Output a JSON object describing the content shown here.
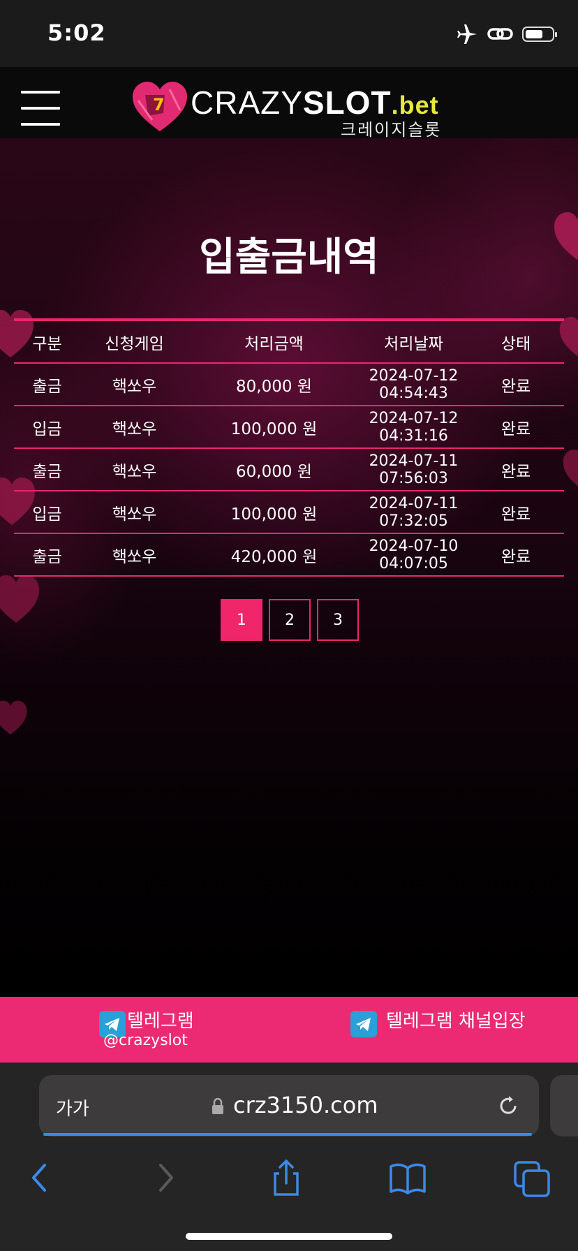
{
  "status_bar": {
    "time": "5:02"
  },
  "header": {
    "logo_crazy": "CRAZY",
    "logo_slot": "SLOT",
    "logo_bet": ".bet",
    "logo_sub": "크레이지슬롯"
  },
  "page": {
    "title": "입출금내역"
  },
  "table": {
    "headers": [
      "구분",
      "신청게임",
      "처리금액",
      "처리날짜",
      "상태"
    ],
    "rows": [
      {
        "type": "출금",
        "game": "핵쏘우",
        "amount": "80,000 원",
        "date": "2024-07-12",
        "time": "04:54:43",
        "status": "완료"
      },
      {
        "type": "입금",
        "game": "핵쏘우",
        "amount": "100,000 원",
        "date": "2024-07-12",
        "time": "04:31:16",
        "status": "완료"
      },
      {
        "type": "출금",
        "game": "핵쏘우",
        "amount": "60,000 원",
        "date": "2024-07-11",
        "time": "07:56:03",
        "status": "완료"
      },
      {
        "type": "입금",
        "game": "핵쏘우",
        "amount": "100,000 원",
        "date": "2024-07-11",
        "time": "07:32:05",
        "status": "완료"
      },
      {
        "type": "출금",
        "game": "핵쏘우",
        "amount": "420,000 원",
        "date": "2024-07-10",
        "time": "04:07:05",
        "status": "완료"
      }
    ]
  },
  "pagination": {
    "pages": [
      "1",
      "2",
      "3"
    ],
    "active": "1"
  },
  "footer": {
    "telegram_label": "텔레그램",
    "telegram_handle": "@crazyslot",
    "telegram_channel_label": "텔레그램 채널입장"
  },
  "browser": {
    "text_size_label": "가가",
    "url": "crz3150.com"
  },
  "colors": {
    "accent": "#ec2a73",
    "table_line": "#e8286e",
    "telegram": "#2a9fd8",
    "link_blue": "#3a8ae8"
  }
}
